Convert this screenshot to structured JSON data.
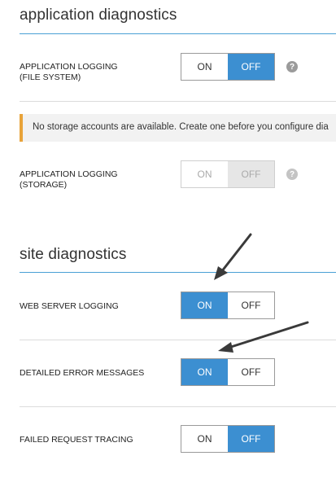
{
  "app_diag": {
    "title": "application diagnostics",
    "logging_fs": {
      "label_line1": "APPLICATION LOGGING",
      "label_line2": "(FILE SYSTEM)",
      "on": "ON",
      "off": "OFF",
      "value": "OFF"
    },
    "notice": "No storage accounts are available. Create one before you configure dia",
    "logging_storage": {
      "label_line1": "APPLICATION LOGGING",
      "label_line2": "(STORAGE)",
      "on": "ON",
      "off": "OFF",
      "value": "OFF",
      "disabled": true
    }
  },
  "site_diag": {
    "title": "site diagnostics",
    "web_server_logging": {
      "label": "WEB SERVER LOGGING",
      "on": "ON",
      "off": "OFF",
      "value": "ON"
    },
    "detailed_errors": {
      "label": "DETAILED ERROR MESSAGES",
      "on": "ON",
      "off": "OFF",
      "value": "ON"
    },
    "failed_request_tracing": {
      "label": "FAILED REQUEST TRACING",
      "on": "ON",
      "off": "OFF",
      "value": "OFF"
    }
  },
  "help_glyph": "?",
  "colors": {
    "accent": "#3c8fd1",
    "section_rule": "#4aa0d5",
    "warning": "#e8a33a",
    "help": "#9b9b9b"
  },
  "icons": {
    "help": "help-icon",
    "annotation": "arrow-annotation"
  }
}
